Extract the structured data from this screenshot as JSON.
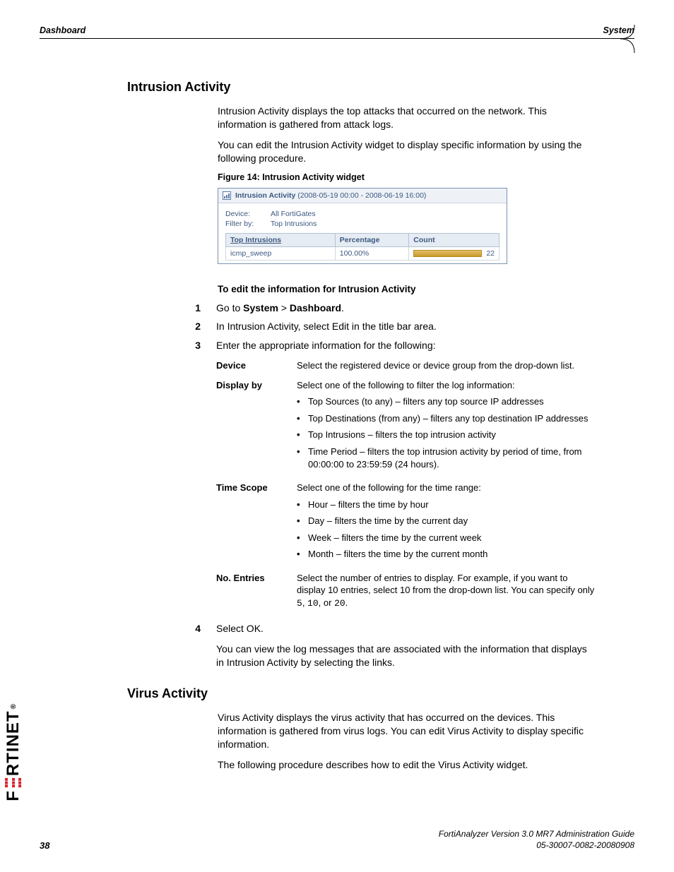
{
  "runhead": {
    "left": "Dashboard",
    "right": "System"
  },
  "section1": {
    "title": "Intrusion Activity",
    "p1": "Intrusion Activity displays the top attacks that occurred on the network. This information is gathered from attack logs.",
    "p2": "You can edit the Intrusion Activity widget to display specific information by using the following procedure.",
    "figcap": "Figure 14: Intrusion Activity widget",
    "widget": {
      "title": "Intrusion Activity",
      "range": "(2008-05-19 00:00 - 2008-06-19 16:00)",
      "device_label": "Device:",
      "device_value": "All FortiGates",
      "filter_label": "Filter by:",
      "filter_value": "Top Intrusions",
      "cols": {
        "c1": "Top Intrusions",
        "c2": "Percentage",
        "c3": "Count"
      },
      "row": {
        "name": "icmp_sweep",
        "pct": "100.00%",
        "count": "22"
      }
    },
    "proc_heading": "To edit the information for Intrusion Activity",
    "steps": {
      "s1a": "Go to ",
      "s1b": "System",
      "s1c": " > ",
      "s1d": "Dashboard",
      "s1e": ".",
      "s2": "In Intrusion Activity, select Edit in the title bar area.",
      "s3": "Enter the appropriate information for the following:",
      "s4": "Select OK.",
      "after4": "You can view the log messages that are associated with the information that displays in Intrusion Activity by selecting the links."
    },
    "fields": {
      "device": {
        "name": "Device",
        "desc": "Select the registered device or device group from the drop-down list."
      },
      "displayby": {
        "name": "Display by",
        "desc": "Select one of the following to filter the log information:",
        "b1": "Top Sources (to any) – filters any top source IP addresses",
        "b2": "Top Destinations (from any) – filters any top destination IP addresses",
        "b3": "Top Intrusions – filters the top intrusion activity",
        "b4": "Time Period – filters the top intrusion activity by period of time, from 00:00:00 to 23:59:59 (24 hours)."
      },
      "timescope": {
        "name": "Time Scope",
        "desc": "Select one of the following for the time range:",
        "b1": "Hour – filters the time by hour",
        "b2": "Day – filters the time by the current day",
        "b3": "Week – filters the time by the current week",
        "b4": "Month – filters the time by the current month"
      },
      "entries": {
        "name": "No. Entries",
        "desc_a": "Select the number of entries to display. For example, if you want to display 10 entries, select 10 from the drop-down list. You can specify only ",
        "v1": "5",
        "sep1": ", ",
        "v2": "10",
        "sep2": ", or ",
        "v3": "20",
        "end": "."
      }
    }
  },
  "section2": {
    "title": "Virus Activity",
    "p1": "Virus Activity displays the virus activity that has occurred on the devices. This information is gathered from virus logs. You can edit Virus Activity to display specific information.",
    "p2": "The following procedure describes how to edit the Virus Activity widget."
  },
  "footer": {
    "line1": "FortiAnalyzer Version 3.0 MR7 Administration Guide",
    "line2": "05-30007-0082-20080908",
    "page": "38"
  },
  "brand": {
    "pre": "F",
    "post": "RTINET"
  }
}
